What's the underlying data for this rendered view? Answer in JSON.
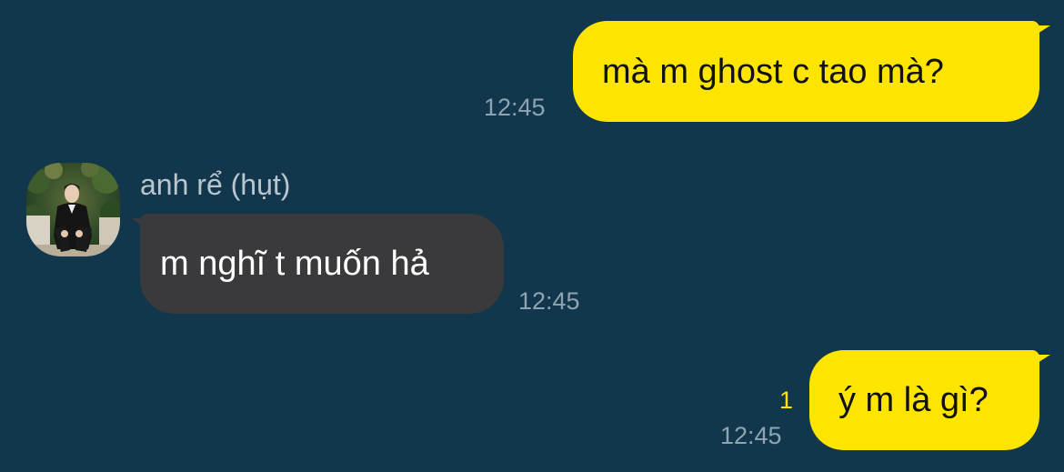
{
  "conversation": {
    "messages": [
      {
        "direction": "outgoing",
        "text": "mà m ghost c tao mà?",
        "time": "12:45"
      },
      {
        "direction": "incoming",
        "sender": "anh rể (hụt)",
        "text": "m nghĩ t muốn hả",
        "time": "12:45"
      },
      {
        "direction": "outgoing",
        "text": "ý m là gì?",
        "time": "12:45",
        "unread_count": "1"
      }
    ]
  },
  "colors": {
    "background": "#12374C",
    "outgoing_bubble": "#FEE500",
    "incoming_bubble": "#3A3A3C",
    "timestamp": "#8FA4B2",
    "unread_indicator": "#FEE500"
  },
  "icons": {
    "avatar": "contact-avatar-photo"
  }
}
